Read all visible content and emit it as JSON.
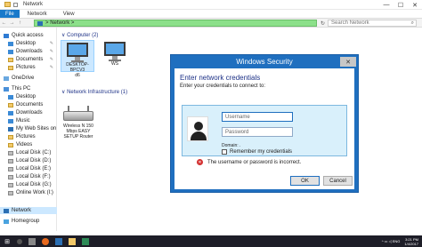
{
  "window": {
    "title": "Network",
    "controls": {
      "minimize": "—",
      "maximize": "☐",
      "close": "✕"
    }
  },
  "ribbon": {
    "tabs": [
      "File",
      "Network",
      "View"
    ]
  },
  "addressbar": {
    "back": "←",
    "forward": "→",
    "up": "↑",
    "path_sep": ">",
    "path": "Network",
    "path_chevron": ">",
    "refresh": "↻",
    "search_placeholder": "Search Network",
    "search_icon": "⌕"
  },
  "sidebar": {
    "items": [
      {
        "label": "Quick access",
        "icon": "star-icon",
        "indent": 1
      },
      {
        "label": "Desktop",
        "icon": "folder-icon",
        "indent": 2,
        "pinned": true
      },
      {
        "label": "Downloads",
        "icon": "download-icon",
        "indent": 2,
        "pinned": true
      },
      {
        "label": "Documents",
        "icon": "folder-icon",
        "indent": 2,
        "pinned": true
      },
      {
        "label": "Pictures",
        "icon": "folder-icon",
        "indent": 2,
        "pinned": true
      },
      {
        "label": "OneDrive",
        "icon": "cloud-icon",
        "indent": 1
      },
      {
        "label": "This PC",
        "icon": "pc-icon",
        "indent": 1
      },
      {
        "label": "Desktop",
        "icon": "folder-icon",
        "indent": 2
      },
      {
        "label": "Documents",
        "icon": "folder-icon",
        "indent": 2
      },
      {
        "label": "Downloads",
        "icon": "download-icon",
        "indent": 2
      },
      {
        "label": "Music",
        "icon": "music-icon",
        "indent": 2
      },
      {
        "label": "My Web Sites on M",
        "icon": "net-icon",
        "indent": 2
      },
      {
        "label": "Pictures",
        "icon": "folder-icon",
        "indent": 2
      },
      {
        "label": "Videos",
        "icon": "folder-icon",
        "indent": 2
      },
      {
        "label": "Local Disk (C:)",
        "icon": "drive-icon",
        "indent": 2
      },
      {
        "label": "Local Disk (D:)",
        "icon": "drive-icon",
        "indent": 2
      },
      {
        "label": "Local Disk (E:)",
        "icon": "drive-icon",
        "indent": 2
      },
      {
        "label": "Local Disk (F:)",
        "icon": "drive-icon",
        "indent": 2
      },
      {
        "label": "Local Disk (G:)",
        "icon": "drive-icon",
        "indent": 2
      },
      {
        "label": "Online Work (I:)",
        "icon": "drive-icon",
        "indent": 2
      },
      {
        "label": "Network",
        "icon": "network-icon",
        "indent": 1,
        "selected": true
      },
      {
        "label": "Homegroup",
        "icon": "homegroup-icon",
        "indent": 1
      }
    ],
    "pin_glyph": "✎"
  },
  "content": {
    "groups": [
      {
        "title": "Computer (2)",
        "chevron": "∨"
      },
      {
        "title": "Network Infrastructure (1)",
        "chevron": "∨"
      }
    ],
    "computers": [
      {
        "name": "DESKTOP-BPCV3\nd6",
        "selected": true
      },
      {
        "name": "WS",
        "selected": false
      }
    ],
    "infrastructure": [
      {
        "name": "Wireless N 150\nMbps EASY\nSETUP Router"
      }
    ]
  },
  "dialog": {
    "title": "Windows Security",
    "close": "✕",
    "heading": "Enter network credentials",
    "subheading": "Enter your credentials to connect to:",
    "username_placeholder": "Username",
    "password_placeholder": "Password",
    "domain_label": "Domain: .",
    "remember_label": "Remember my credentials",
    "error_icon": "✕",
    "error_text": "The username or password is incorrect.",
    "ok_label": "OK",
    "cancel_label": "Cancel"
  },
  "taskbar": {
    "start_glyph": "⊞",
    "time": "3:21 PM",
    "date": "1/4/2017",
    "tray_text": "^ ▭ ◁ ENG"
  },
  "colors": {
    "accent": "#1979ca",
    "dialog_frame": "#1f6fbf",
    "address_bg": "#8ce08a",
    "error": "#d32f2f",
    "group_title": "#1e3287",
    "selection": "#cce8ff"
  }
}
